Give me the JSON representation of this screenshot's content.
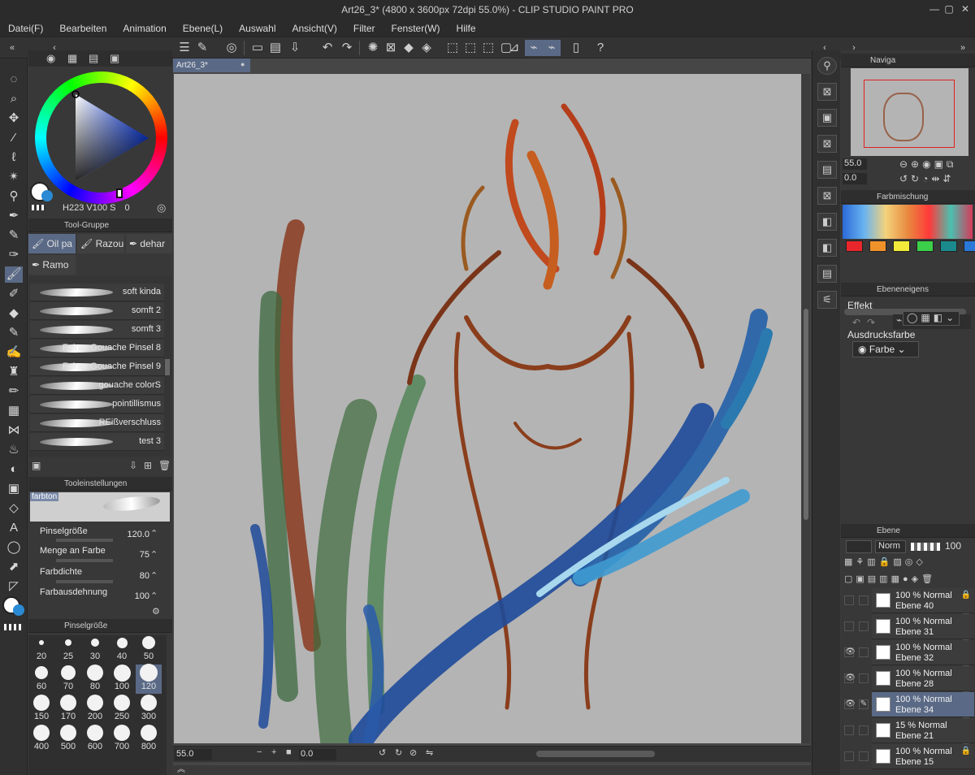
{
  "app": {
    "title": "Art26_3* (4800 x 3600px 72dpi 55.0%)  - CLIP STUDIO PAINT PRO"
  },
  "menu": [
    "Datei(F)",
    "Bearbeiten",
    "Animation",
    "Ebene(L)",
    "Auswahl",
    "Ansicht(V)",
    "Filter",
    "Fenster(W)",
    "Hilfe"
  ],
  "document": {
    "tab_label": "Art26_3*"
  },
  "color": {
    "readout_h": "223",
    "readout_s": "100",
    "readout_v": "100",
    "readout_s_label": "S",
    "readout_v_label": "0",
    "main": "#ffffff",
    "sub": "#2a8ad4"
  },
  "tool_group": {
    "header": "Tool-Gruppe",
    "tabs": [
      "Oil pa",
      "Razou",
      "dehar",
      "Ramo"
    ]
  },
  "brushes": [
    {
      "name": "soft kinda",
      "locked": true
    },
    {
      "name": "somft 2",
      "locked": false
    },
    {
      "name": "somft 3",
      "locked": false
    },
    {
      "name": "Feiner Gouache Pinsel 8",
      "locked": true
    },
    {
      "name": "Feiner Gouache Pinsel 9",
      "locked": false
    },
    {
      "name": "gouache colorS",
      "locked": false
    },
    {
      "name": "pointillismus",
      "locked": false
    },
    {
      "name": "REißverschluss",
      "locked": true
    },
    {
      "name": "test 3",
      "locked": false
    }
  ],
  "tool_settings": {
    "header": "Tooleinstellungen",
    "preview_label": "farbton",
    "rows": [
      {
        "label": "Pinselgröße",
        "value": "120.0"
      },
      {
        "label": "Menge an Farbe",
        "value": "75"
      },
      {
        "label": "Farbdichte",
        "value": "80"
      },
      {
        "label": "Farbausdehnung",
        "value": "100"
      }
    ]
  },
  "brush_size": {
    "header": "Pinselgröße",
    "sizes": [
      "20",
      "25",
      "30",
      "40",
      "50",
      "60",
      "70",
      "80",
      "100",
      "120",
      "150",
      "170",
      "200",
      "250",
      "300",
      "400",
      "500",
      "600",
      "700",
      "800"
    ],
    "selected": "120"
  },
  "status": {
    "zoom": "55.0",
    "rotation": "0.0"
  },
  "navigator": {
    "header": "Naviga",
    "zoom": "55.0",
    "rotation": "0.0"
  },
  "color_mixing": {
    "header": "Farbmischung",
    "swatches": [
      "#e8262b",
      "#f0922a",
      "#f2e93a",
      "#3cd04a",
      "#1a8a8c",
      "#2a78d8"
    ]
  },
  "layer_property": {
    "header": "Ebeneneigens",
    "effect_label": "Effekt",
    "expression_label": "Ausdrucksfarbe",
    "expression_value": "Farbe"
  },
  "layers_panel": {
    "header": "Ebene",
    "blend_mode": "Norm",
    "opacity": "100",
    "layers": [
      {
        "mode": "100 % Normal",
        "name": "Ebene 40",
        "visible": false,
        "locked": true,
        "selected": false
      },
      {
        "mode": "100 % Normal",
        "name": "Ebene 31",
        "visible": false,
        "locked": false,
        "selected": false
      },
      {
        "mode": "100 % Normal",
        "name": "Ebene 32",
        "visible": true,
        "locked": false,
        "selected": false
      },
      {
        "mode": "100 % Normal",
        "name": "Ebene 28",
        "visible": true,
        "locked": false,
        "selected": false
      },
      {
        "mode": "100 % Normal",
        "name": "Ebene 34",
        "visible": true,
        "locked": false,
        "selected": true
      },
      {
        "mode": "15 % Normal",
        "name": "Ebene 21",
        "visible": false,
        "locked": false,
        "selected": false
      },
      {
        "mode": "100 % Normal",
        "name": "Ebene 15",
        "visible": false,
        "locked": true,
        "selected": false
      }
    ]
  }
}
